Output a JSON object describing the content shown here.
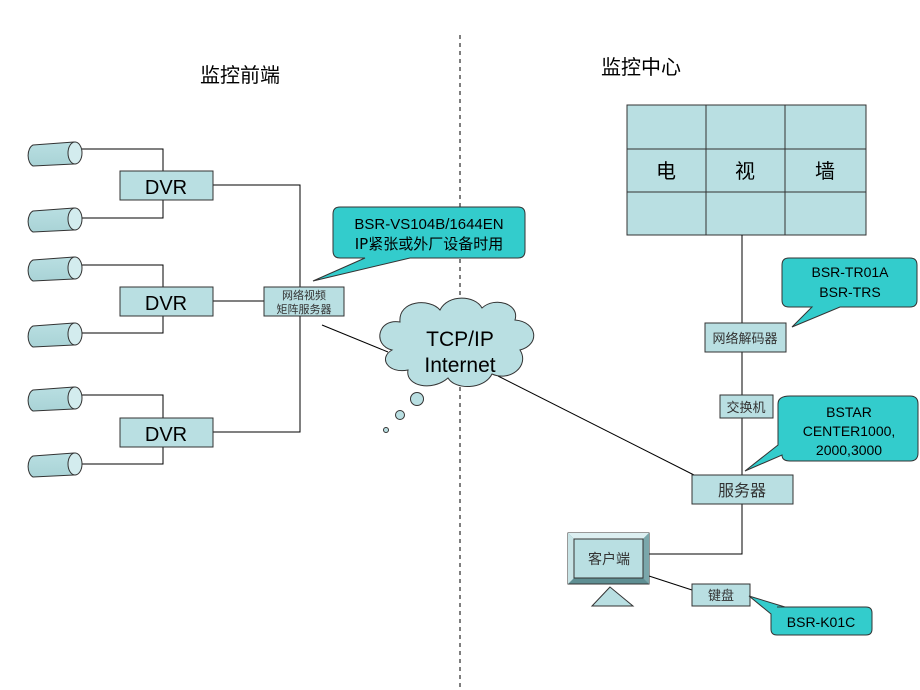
{
  "titles": {
    "front_end": "监控前端",
    "center": "监控中心"
  },
  "front": {
    "dvr_label": "DVR",
    "dvrs": [
      {
        "label": "DVR"
      },
      {
        "label": "DVR"
      },
      {
        "label": "DVR"
      }
    ],
    "matrix_server": {
      "line1": "网络视频",
      "line2": "矩阵服务器"
    },
    "callout_matrix": {
      "line1": "BSR-VS104B/1644EN",
      "line2": "IP紧张或外厂设备时用"
    }
  },
  "network": {
    "line1": "TCP/IP",
    "line2": "Internet"
  },
  "center": {
    "tv_wall": {
      "cells": [
        "电",
        "视",
        "墙"
      ]
    },
    "decoder": "网络解码器",
    "callout_decoder": {
      "line1": "BSR-TR01A",
      "line2": "BSR-TRS"
    },
    "switch": "交换机",
    "server": "服务器",
    "callout_server": {
      "line1": "BSTAR",
      "line2": "CENTER1000,",
      "line3": "2000,3000"
    },
    "client": "客户端",
    "keyboard": "键盘",
    "callout_keyboard": "BSR-K01C"
  },
  "colors": {
    "box_fill": "#b9dfe2",
    "callout_fill": "#33cccc",
    "line": "#000000"
  }
}
